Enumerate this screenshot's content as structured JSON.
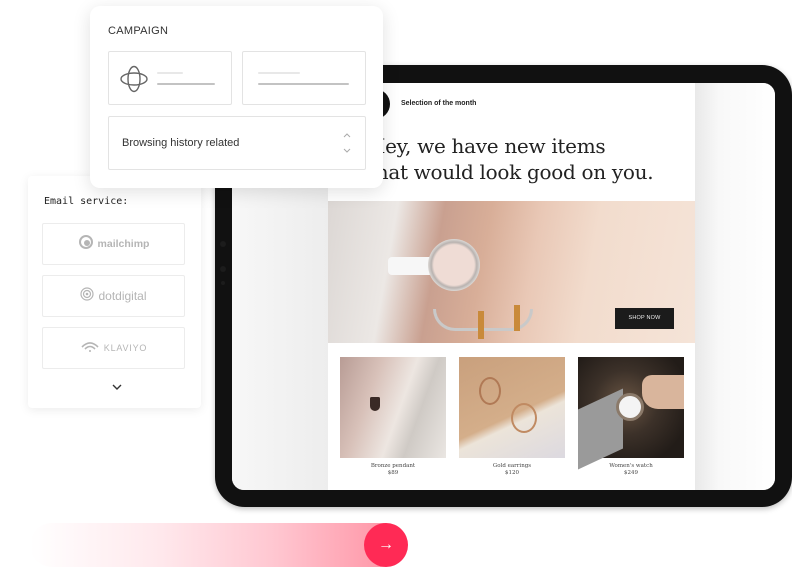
{
  "campaign_card": {
    "title": "CAMPAIGN",
    "options": [
      {
        "icon": "orbit-icon",
        "selected": false
      },
      {
        "icon": null,
        "selected": false
      }
    ],
    "select": {
      "value": "Browsing history related",
      "arrow_up": "⌃",
      "arrow_down": "⌄"
    }
  },
  "email_service_card": {
    "title": "Email service:",
    "options": [
      {
        "name": "mailchimp",
        "icon": "mailchimp-icon"
      },
      {
        "name": "dotdigital",
        "icon": "dotdigital-icon"
      },
      {
        "name": "KLAVIYO",
        "icon": "klaviyo-icon"
      }
    ],
    "more_chevron": "⌄"
  },
  "email_preview": {
    "tag": "Selection of the month",
    "headline_line1": "Hey, we have new items",
    "headline_line2": "that would look good on you.",
    "hero_button": "SHOP NOW",
    "products": [
      {
        "name": "Bronze pendant",
        "price": "$89"
      },
      {
        "name": "Gold earrings",
        "price": "$120"
      },
      {
        "name": "Women's watch",
        "price": "$249"
      }
    ]
  },
  "cta": {
    "icon": "arrow-right-icon",
    "glyph": "→",
    "accent_color": "#ff2a55"
  }
}
